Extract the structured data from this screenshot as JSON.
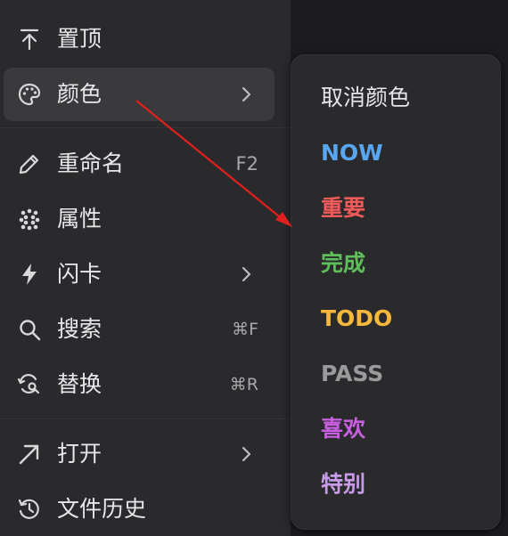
{
  "menu": {
    "items": [
      {
        "label": "置顶",
        "icon": "pin-top-icon",
        "shortcut": ""
      },
      {
        "label": "颜色",
        "icon": "palette-icon",
        "shortcut": ""
      },
      {
        "label": "重命名",
        "icon": "pencil-icon",
        "shortcut": "F2"
      },
      {
        "label": "属性",
        "icon": "properties-dots-icon",
        "shortcut": ""
      },
      {
        "label": "闪卡",
        "icon": "lightning-icon",
        "shortcut": ""
      },
      {
        "label": "搜索",
        "icon": "search-icon",
        "shortcut": "⌘F"
      },
      {
        "label": "替换",
        "icon": "replace-icon",
        "shortcut": "⌘R"
      },
      {
        "label": "打开",
        "icon": "open-arrow-icon",
        "shortcut": ""
      },
      {
        "label": "文件历史",
        "icon": "history-icon",
        "shortcut": ""
      }
    ]
  },
  "submenu": {
    "items": [
      {
        "label": "取消颜色",
        "color": "#e6e6e6"
      },
      {
        "label": "NOW",
        "color": "#58a6f0"
      },
      {
        "label": "重要",
        "color": "#f05a5a"
      },
      {
        "label": "完成",
        "color": "#5fbf5a"
      },
      {
        "label": "TODO",
        "color": "#f5b83d"
      },
      {
        "label": "PASS",
        "color": "#9a9a9a"
      },
      {
        "label": "喜欢",
        "color": "#c85ee0"
      },
      {
        "label": "特别",
        "color": "#c79be8"
      }
    ]
  },
  "colors": {
    "background": "#1c1c1e",
    "menu": "#2a2a2c",
    "active_item": "#3a3a3c",
    "annotation_arrow": "#e0201c"
  }
}
